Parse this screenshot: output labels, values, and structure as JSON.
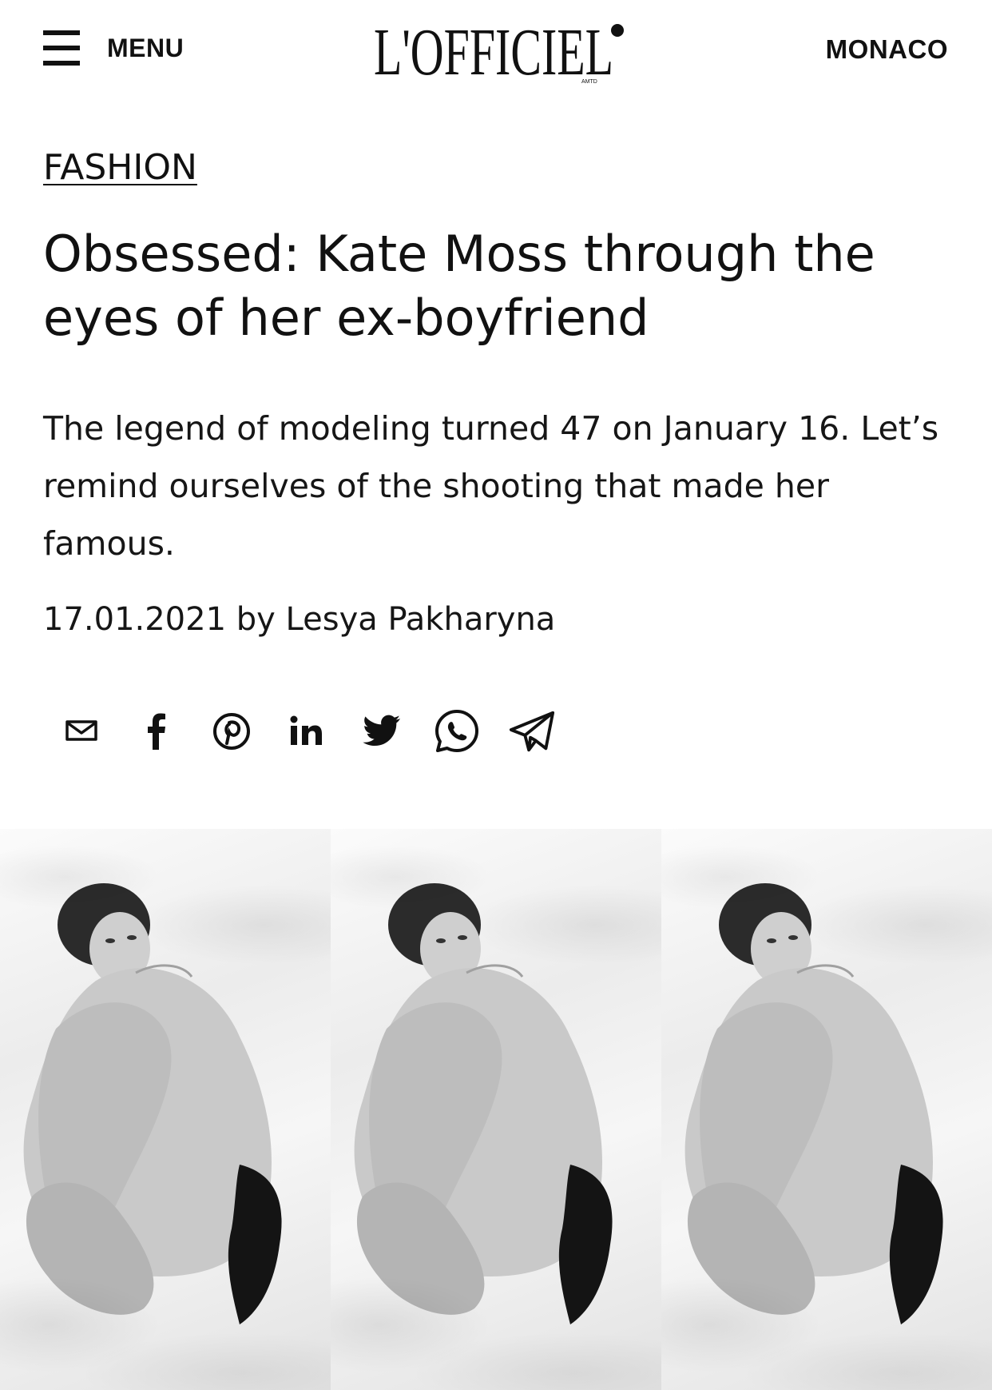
{
  "header": {
    "menu_label": "MENU",
    "logo_text": "L'OFFICIEL",
    "logo_sub": "AMTD",
    "region_label": "MONACO"
  },
  "article": {
    "category": "FASHION",
    "title": "Obsessed: Kate Moss through the eyes of her ex-boyfriend",
    "lede": "The legend of modeling turned 47 on January 16. Let’s remind ourselves of the shooting that made her famous.",
    "date": "17.01.2021",
    "byline_prefix": "by",
    "author": "Lesya Pakharyna"
  },
  "share": {
    "items": [
      {
        "icon": "mail-icon",
        "label": "email"
      },
      {
        "icon": "facebook-icon",
        "label": "facebook"
      },
      {
        "icon": "pinterest-icon",
        "label": "pinterest"
      },
      {
        "icon": "linkedin-icon",
        "label": "linkedin"
      },
      {
        "icon": "twitter-icon",
        "label": "twitter"
      },
      {
        "icon": "whatsapp-icon",
        "label": "whatsapp"
      },
      {
        "icon": "telegram-icon",
        "label": "telegram"
      }
    ]
  },
  "hero": {
    "panel_count": 3,
    "style": "black-and-white photograph repeated three times"
  },
  "colors": {
    "text": "#111111",
    "background": "#ffffff"
  }
}
